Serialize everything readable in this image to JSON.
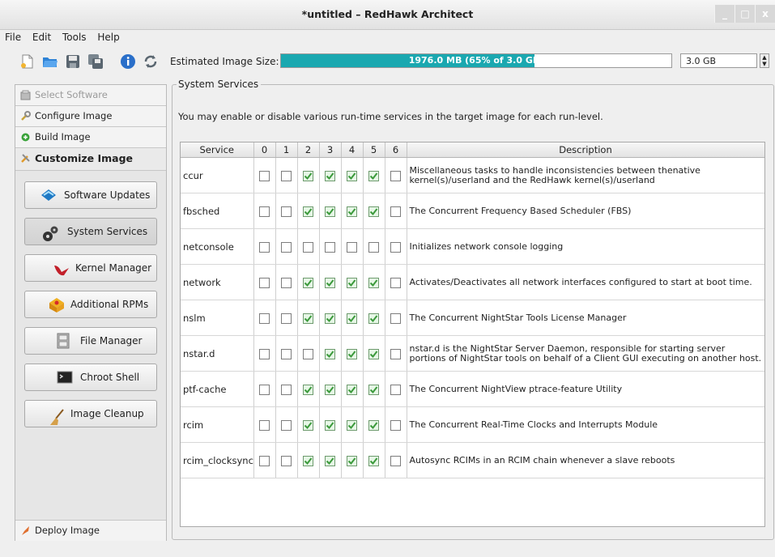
{
  "window": {
    "title": "*untitled – RedHawk Architect",
    "controls": [
      "_",
      "□",
      "x"
    ]
  },
  "menu": [
    "File",
    "Edit",
    "Tools",
    "Help"
  ],
  "toolbar": {
    "icons": [
      "new-file-icon",
      "open-folder-icon",
      "save-icon",
      "save-as-icon",
      "info-icon",
      "refresh-icon"
    ],
    "estimated_label": "Estimated Image Size:",
    "progress_text": "1976.0 MB (65% of 3.0 GB)",
    "progress_fraction": 0.65,
    "size_value": "3.0 GB"
  },
  "nav": {
    "tabs": [
      {
        "label": "Select Software",
        "state": "disabled"
      },
      {
        "label": "Configure Image",
        "state": "normal"
      },
      {
        "label": "Build Image",
        "state": "normal"
      },
      {
        "label": "Customize Image",
        "state": "active"
      }
    ],
    "buttons": [
      {
        "label": "Software Updates",
        "icon": "software-updates-icon"
      },
      {
        "label": "System Services",
        "icon": "gears-icon"
      },
      {
        "label": "Kernel Manager",
        "icon": "kernel-bird-icon"
      },
      {
        "label": "Additional RPMs",
        "icon": "rpm-package-icon"
      },
      {
        "label": "File Manager",
        "icon": "file-cabinet-icon"
      },
      {
        "label": "Chroot Shell",
        "icon": "terminal-icon"
      },
      {
        "label": "Image Cleanup",
        "icon": "broom-icon"
      }
    ],
    "deploy_label": "Deploy Image"
  },
  "main": {
    "group_title": "System Services",
    "description": "You may enable or disable various run-time services in the target image for each run-level.",
    "columns": [
      "Service",
      "0",
      "1",
      "2",
      "3",
      "4",
      "5",
      "6",
      "Description"
    ],
    "rows": [
      {
        "service": "ccur",
        "levels": [
          0,
          0,
          1,
          1,
          1,
          1,
          0
        ],
        "description": "Miscellaneous tasks to handle inconsistencies between thenative kernel(s)/userland and the RedHawk kernel(s)/userland"
      },
      {
        "service": "fbsched",
        "levels": [
          0,
          0,
          1,
          1,
          1,
          1,
          0
        ],
        "description": "The Concurrent Frequency Based Scheduler (FBS)"
      },
      {
        "service": "netconsole",
        "levels": [
          0,
          0,
          0,
          0,
          0,
          0,
          0
        ],
        "description": "Initializes network console logging"
      },
      {
        "service": "network",
        "levels": [
          0,
          0,
          1,
          1,
          1,
          1,
          0
        ],
        "description": "Activates/Deactivates all network interfaces configured to start at boot time."
      },
      {
        "service": "nslm",
        "levels": [
          0,
          0,
          1,
          1,
          1,
          1,
          0
        ],
        "description": "The Concurrent NightStar Tools License Manager"
      },
      {
        "service": "nstar.d",
        "levels": [
          0,
          0,
          0,
          1,
          1,
          1,
          0
        ],
        "description": "nstar.d is the NightStar Server Daemon, responsible for starting server portions of NightStar tools on behalf of a Client GUI executing on another host."
      },
      {
        "service": "ptf-cache",
        "levels": [
          0,
          0,
          1,
          1,
          1,
          1,
          0
        ],
        "description": "The Concurrent NightView ptrace-feature Utility"
      },
      {
        "service": "rcim",
        "levels": [
          0,
          0,
          1,
          1,
          1,
          1,
          0
        ],
        "description": "The Concurrent Real-Time Clocks and Interrupts Module"
      },
      {
        "service": "rcim_clocksync",
        "levels": [
          0,
          0,
          1,
          1,
          1,
          1,
          0
        ],
        "description": "Autosync RCIMs in an RCIM chain whenever a slave reboots"
      }
    ]
  },
  "colors": {
    "progress": "#1aa8b0",
    "check": "#3c9a3c"
  }
}
